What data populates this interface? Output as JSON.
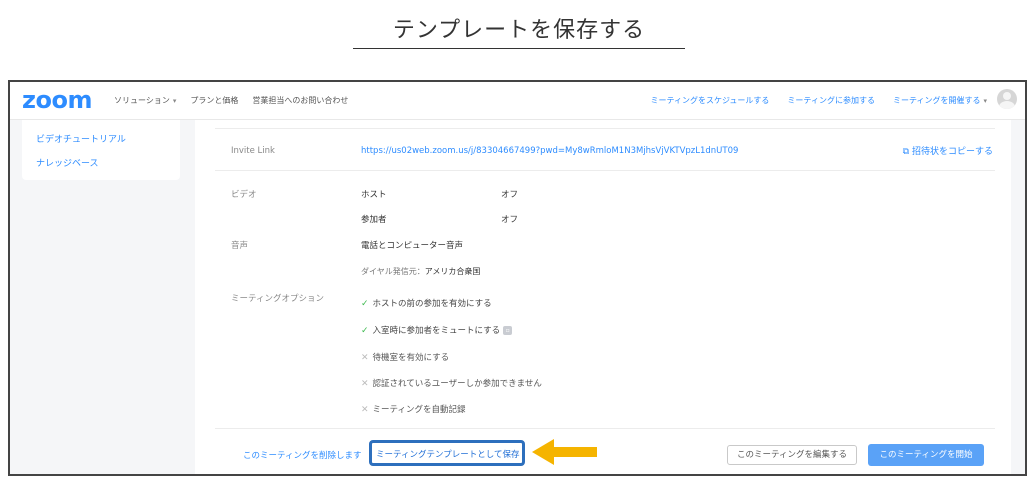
{
  "caption": {
    "title": "テンプレートを保存する"
  },
  "header": {
    "logo": "zoom",
    "nav_left": [
      {
        "label": "ソリューション",
        "has_caret": true
      },
      {
        "label": "プランと価格",
        "has_caret": false
      },
      {
        "label": "営業担当へのお問い合わせ",
        "has_caret": false
      }
    ],
    "nav_right": [
      {
        "label": "ミーティングをスケジュールする",
        "has_caret": false
      },
      {
        "label": "ミーティングに参加する",
        "has_caret": false
      },
      {
        "label": "ミーティングを開催する",
        "has_caret": true
      }
    ]
  },
  "sidebar": {
    "items": [
      {
        "label": "ビデオチュートリアル"
      },
      {
        "label": "ナレッジベース"
      }
    ]
  },
  "meeting": {
    "invite_label": "Invite Link",
    "invite_url": "https://us02web.zoom.us/j/83304667499?pwd=My8wRmloM1N3MjhsVjVKTVpzL1dnUT09",
    "copy_invite": "招待状をコピーする",
    "video_label": "ビデオ",
    "host_label": "ホスト",
    "host_value": "オフ",
    "participant_label": "参加者",
    "participant_value": "オフ",
    "audio_label": "音声",
    "audio_value": "電話とコンピューター音声",
    "dial_label": "ダイヤル発信元：",
    "dial_value": "アメリカ合衆国",
    "options_label": "ミーティングオプション",
    "options": [
      {
        "label": "ホストの前の参加を有効にする",
        "enabled": true
      },
      {
        "label": "入室時に参加者をミュートにする",
        "enabled": true
      },
      {
        "label": "待機室を有効にする",
        "enabled": false
      },
      {
        "label": "認証されているユーザーしか参加できません",
        "enabled": false
      },
      {
        "label": "ミーティングを自動記録",
        "enabled": false
      }
    ]
  },
  "actions": {
    "delete_label": "このミーティングを削除します",
    "save_template_label": "ミーティングテンプレートとして保存",
    "edit_label": "このミーティングを編集する",
    "start_label": "このミーティングを開始"
  },
  "colors": {
    "brand": "#2d8cff",
    "highlight_box": "#2d6fbd",
    "arrow": "#f5b400",
    "primary_button": "#5aa2f7"
  },
  "icons": {
    "check": "check-icon",
    "cross": "cross-icon",
    "copy": "copy-link-icon",
    "info": "info-icon",
    "avatar": "user-avatar-icon",
    "caret": "chevron-down-icon",
    "annotation_arrow": "arrow-left-icon"
  }
}
